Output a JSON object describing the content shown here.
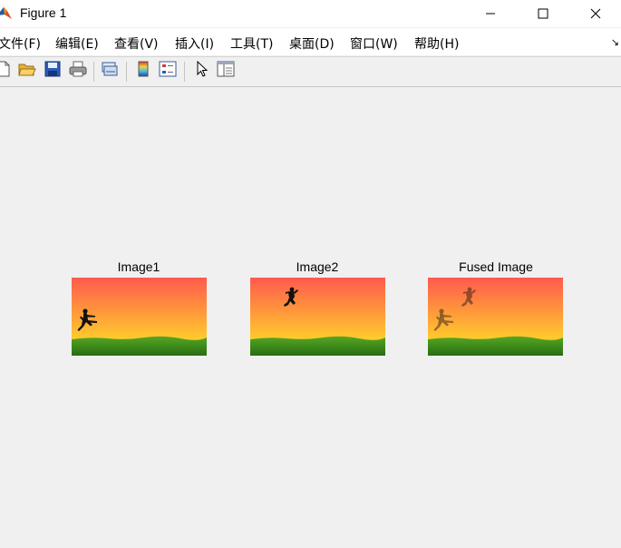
{
  "window": {
    "title": "Figure 1",
    "controls": [
      "minimize-icon",
      "maximize-icon",
      "close-icon"
    ]
  },
  "menubar": {
    "items": [
      "文件(F)",
      "编辑(E)",
      "查看(V)",
      "插入(I)",
      "工具(T)",
      "桌面(D)",
      "窗口(W)",
      "帮助(H)"
    ]
  },
  "toolbar": {
    "buttons": [
      "new-figure-icon",
      "open-file-icon",
      "save-icon",
      "print-icon",
      "link-plot-icon",
      "colorbar-icon",
      "legend-icon",
      "select-pointer-icon",
      "property-inspector-icon"
    ]
  },
  "figure": {
    "axes": [
      {
        "title": "Image1",
        "content": "one-silhouette-left"
      },
      {
        "title": "Image2",
        "content": "one-silhouette-center"
      },
      {
        "title": "Fused Image",
        "content": "two-silhouettes-blended"
      }
    ]
  },
  "colors": {
    "sky_top": "#ff5a4e",
    "sky_bottom": "#ffd52a",
    "grass": "#3e8c1a",
    "figure_bg": "#f0f0f0",
    "accent_blue": "#1e6fc4"
  }
}
